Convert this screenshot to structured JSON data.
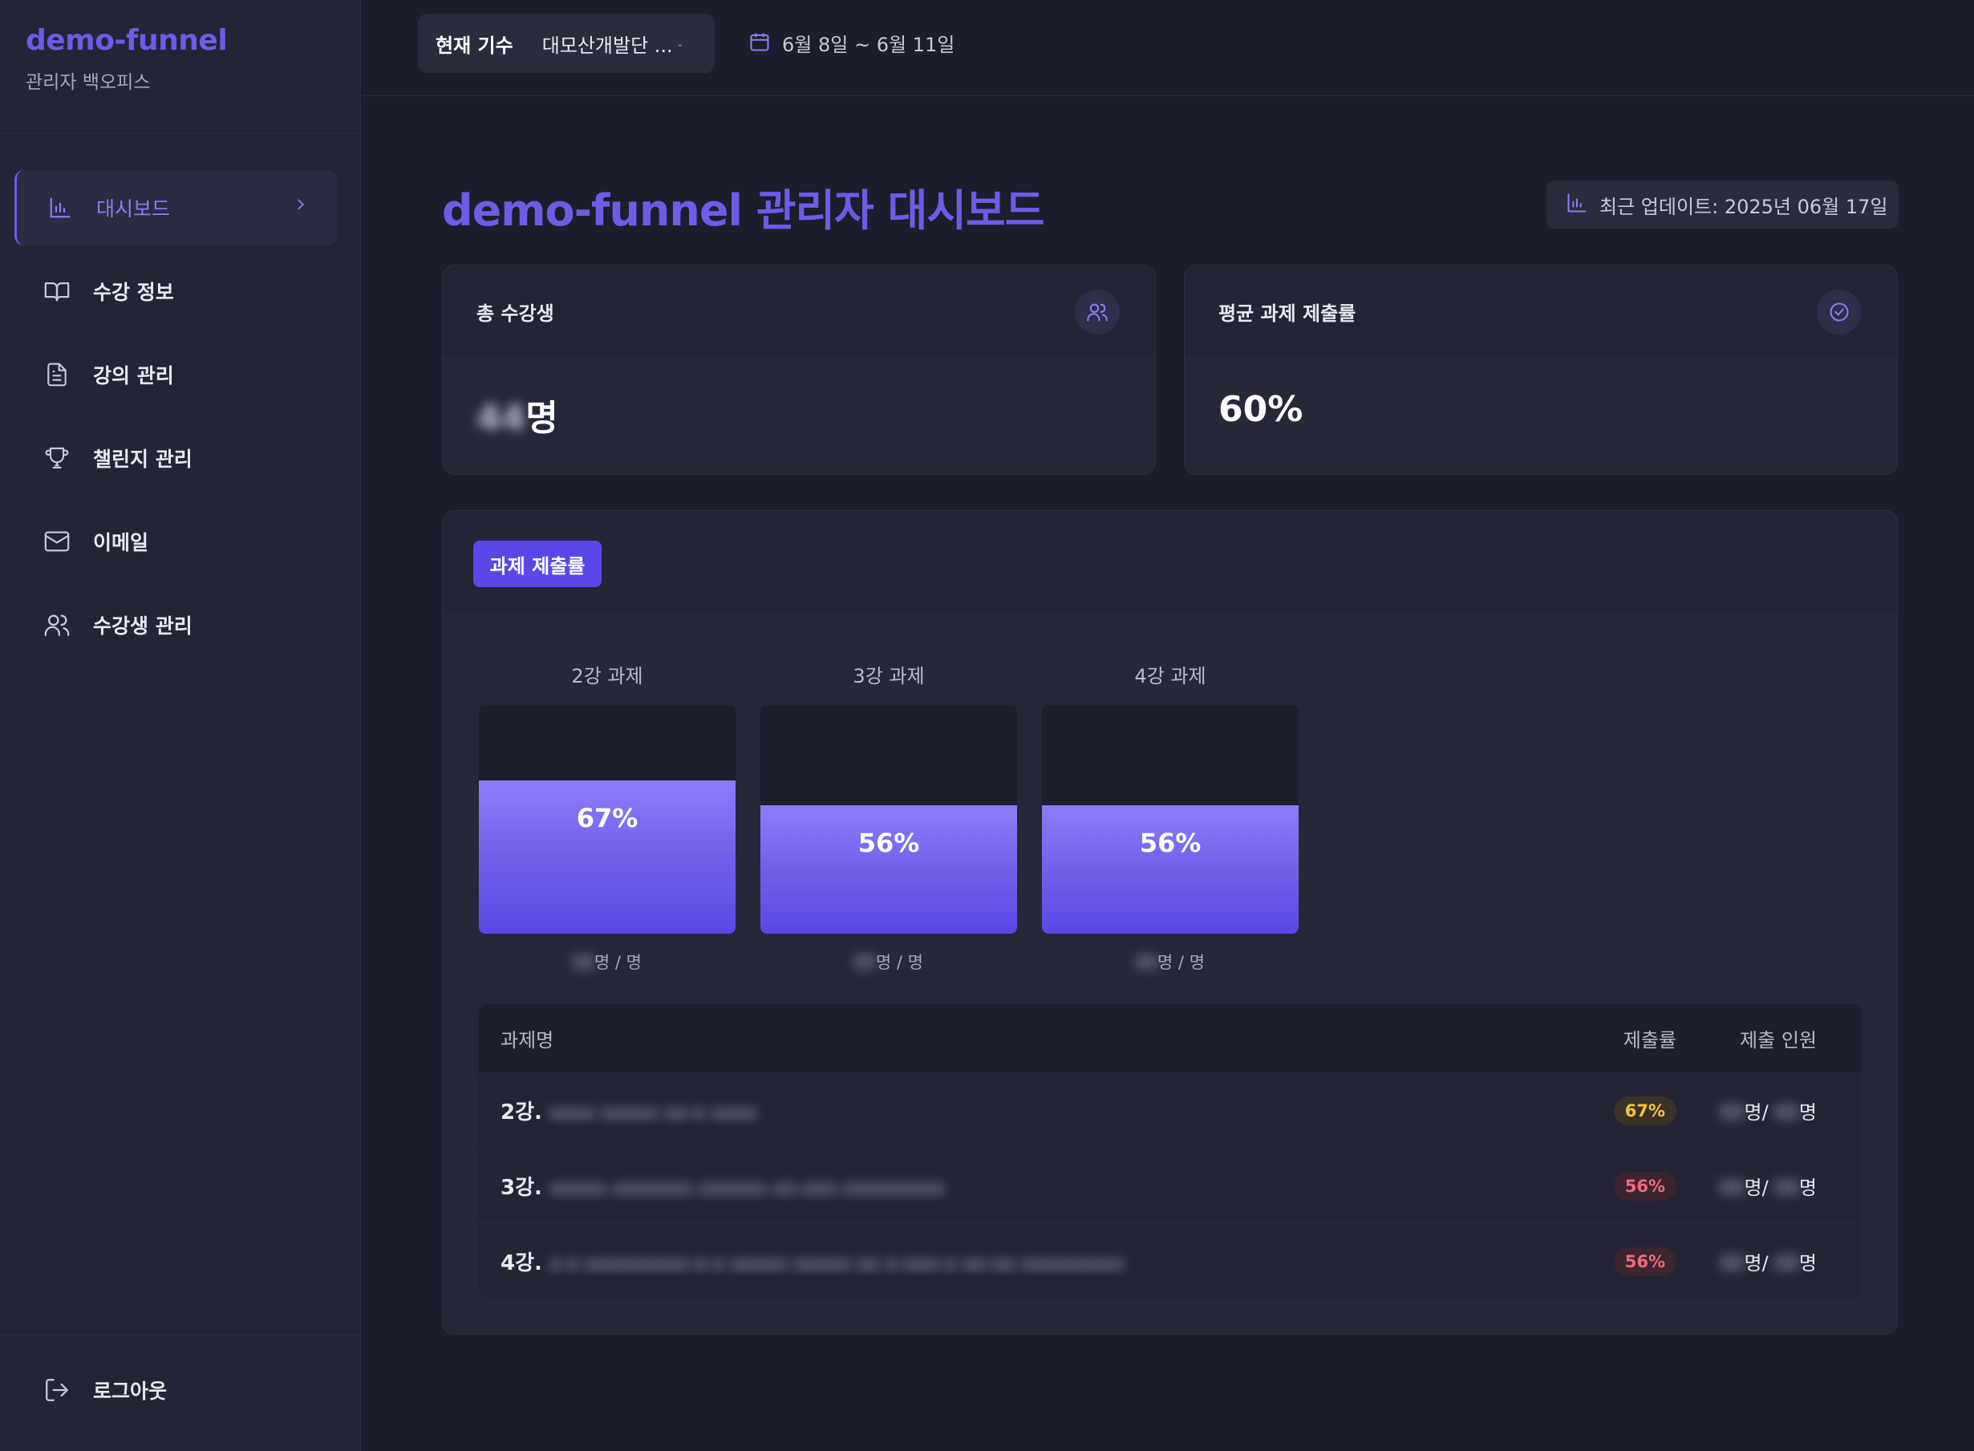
{
  "brand": {
    "title": "demo-funnel",
    "subtitle": "관리자 백오피스"
  },
  "sidebar": {
    "items": [
      {
        "label": "대시보드",
        "icon": "bar-chart-icon",
        "active": true
      },
      {
        "label": "수강 정보",
        "icon": "book-icon"
      },
      {
        "label": "강의 관리",
        "icon": "document-icon"
      },
      {
        "label": "챌린지 관리",
        "icon": "trophy-icon"
      },
      {
        "label": "이메일",
        "icon": "mail-icon"
      },
      {
        "label": "수강생 관리",
        "icon": "users-icon"
      }
    ],
    "logout_label": "로그아웃"
  },
  "topbar": {
    "cohort_label": "현재 기수",
    "cohort_value": "대모산개발단 ...",
    "date_range": "6월 8일 ~ 6월 11일"
  },
  "page": {
    "title": "demo-funnel 관리자 대시보드",
    "updated": "최근 업데이트: 2025년 06월 17일"
  },
  "stats": {
    "total_students": {
      "label": "총 수강생",
      "value_hidden": "44",
      "unit": "명"
    },
    "avg_submission": {
      "label": "평균 과제 제출률",
      "value": "60%"
    }
  },
  "submissions": {
    "tab_label": "과제 제출률",
    "bars": [
      {
        "label": "2강 과제",
        "rate": 67,
        "rate_text": "67%",
        "count_text": "명 / 명"
      },
      {
        "label": "3강 과제",
        "rate": 56,
        "rate_text": "56%",
        "count_text": "명 / 명"
      },
      {
        "label": "4강 과제",
        "rate": 56,
        "rate_text": "56%",
        "count_text": "명 / 명"
      }
    ],
    "table": {
      "headers": {
        "name": "과제명",
        "rate": "제출률",
        "count": "제출 인원"
      },
      "rows": [
        {
          "prefix": "2강.",
          "rate": "67%",
          "status_color": "#f5c542"
        },
        {
          "prefix": "3강.",
          "rate": "56%",
          "status_color": "#f06a7c"
        },
        {
          "prefix": "4강.",
          "rate": "56%",
          "status_color": "#f06a7c"
        }
      ],
      "count_unit": "명/",
      "count_unit_end": "명"
    }
  },
  "colors": {
    "accent": "#6c5ce7",
    "background": "#1d1e2b",
    "panel": "#262839"
  }
}
